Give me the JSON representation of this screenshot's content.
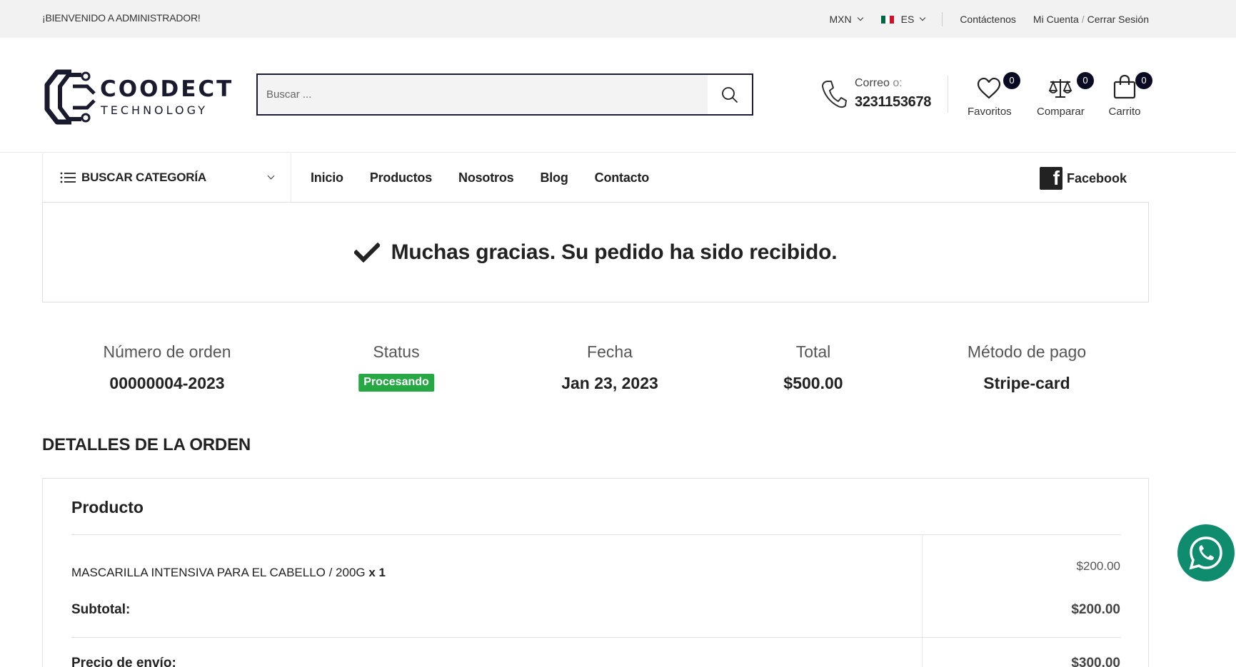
{
  "topbar": {
    "welcome": "¡BIENVENIDO A ADMINISTRADOR!",
    "currency": "MXN",
    "language": "ES",
    "contact": "Contáctenos",
    "account": "Mi Cuenta",
    "separator": "/",
    "logout": "Cerrar Sesión"
  },
  "logo": {
    "line1": "COODECT",
    "line2": "TECHNOLOGY"
  },
  "search": {
    "placeholder": "Buscar ..."
  },
  "contact": {
    "label": "Correo",
    "label_suffix": "o:",
    "phone": "3231153678"
  },
  "header_icons": {
    "favorites": {
      "label": "Favoritos",
      "count": "0"
    },
    "compare": {
      "label": "Comparar",
      "count": "0"
    },
    "cart": {
      "label": "Carrito",
      "count": "0"
    }
  },
  "nav": {
    "category_label": "BUSCAR CATEGORÍA",
    "items": [
      "Inicio",
      "Productos",
      "Nosotros",
      "Blog",
      "Contacto"
    ],
    "facebook": "Facebook"
  },
  "success": {
    "message": "Muchas gracias. Su pedido ha sido recibido."
  },
  "order": {
    "number_label": "Número de orden",
    "number": "00000004-2023",
    "status_label": "Status",
    "status": "Procesando",
    "date_label": "Fecha",
    "date": "Jan 23, 2023",
    "total_label": "Total",
    "total": "$500.00",
    "payment_label": "Método de pago",
    "payment": "Stripe-card"
  },
  "details": {
    "title": "DETALLES DE LA ORDEN",
    "product_header": "Producto",
    "item_name": "MASCARILLA INTENSIVA PARA EL CABELLO / 200G",
    "item_qty": "x 1",
    "item_price": "$200.00",
    "subtotal_label": "Subtotal:",
    "subtotal": "$200.00",
    "shipping_label": "Precio de envío:",
    "shipping": "$300.00"
  },
  "colors": {
    "brand_dark": "#1c1c3a",
    "status_green": "#28a745",
    "whatsapp": "#0f8c6e",
    "topbar_bg": "#f2f2f2"
  }
}
